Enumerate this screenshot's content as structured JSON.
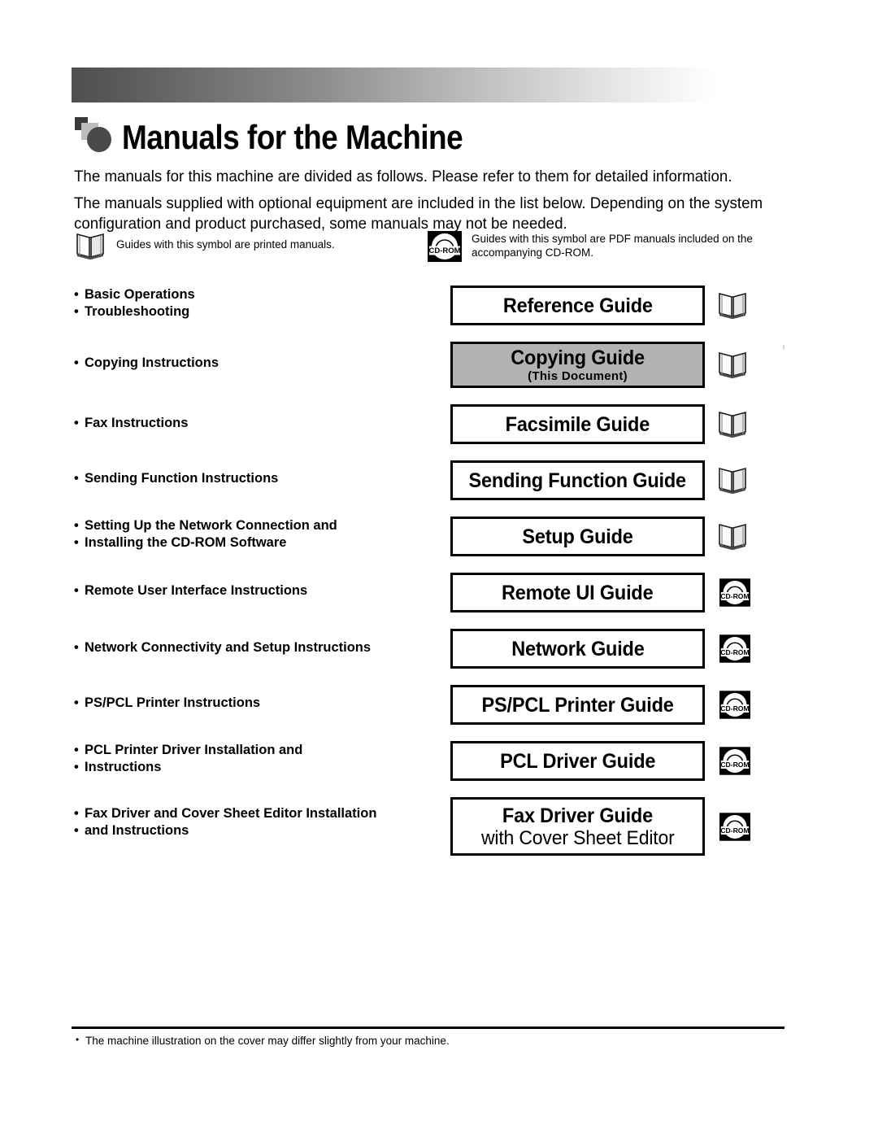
{
  "page": {
    "title": "Manuals for the Machine",
    "title_icon": "overlapping-squares-circle-icon",
    "intro_paragraphs": [
      "The manuals for this machine are divided as follows. Please refer to them for detailed information.",
      "The manuals supplied with optional equipment are included in the list below. Depending on the system configuration and product purchased, some manuals may not be needed."
    ],
    "footer_note": "The machine illustration on the cover may differ slightly from your machine."
  },
  "legend": {
    "printed": {
      "icon": "open-book-icon",
      "caption": "Guides with this symbol are printed manuals."
    },
    "pdf": {
      "icon": "cd-rom-icon",
      "icon_label": "CD-ROM",
      "caption": "Guides with this symbol are PDF manuals included on the accompanying CD-ROM."
    }
  },
  "colors": {
    "highlight_gray": "#b3b3b3",
    "banner_dark": "#4f4f4f",
    "border": "#000000",
    "text": "#000000"
  },
  "rows": [
    {
      "descriptions": [
        "Basic Operations",
        "Troubleshooting"
      ],
      "guide_title": "Reference Guide",
      "guide_subtitle": "",
      "media": "printed",
      "highlighted": false
    },
    {
      "descriptions": [
        "Copying Instructions"
      ],
      "guide_title": "Copying Guide",
      "guide_subtitle": "(This Document)",
      "media": "printed",
      "highlighted": true
    },
    {
      "descriptions": [
        "Fax Instructions"
      ],
      "guide_title": "Facsimile Guide",
      "guide_subtitle": "",
      "media": "printed",
      "highlighted": false
    },
    {
      "descriptions": [
        "Sending Function Instructions"
      ],
      "guide_title": "Sending Function Guide",
      "guide_subtitle": "",
      "media": "printed",
      "highlighted": false
    },
    {
      "descriptions": [
        "Setting Up the Network Connection and",
        "Installing the CD-ROM Software"
      ],
      "guide_title": "Setup Guide",
      "guide_subtitle": "",
      "media": "printed",
      "highlighted": false
    },
    {
      "descriptions": [
        "Remote User Interface Instructions"
      ],
      "guide_title": "Remote UI Guide",
      "guide_subtitle": "",
      "media": "cdrom",
      "highlighted": false
    },
    {
      "descriptions": [
        "Network Connectivity and Setup Instructions"
      ],
      "guide_title": "Network Guide",
      "guide_subtitle": "",
      "media": "cdrom",
      "highlighted": false
    },
    {
      "descriptions": [
        "PS/PCL Printer Instructions"
      ],
      "guide_title": "PS/PCL Printer Guide",
      "guide_subtitle": "",
      "media": "cdrom",
      "highlighted": false
    },
    {
      "descriptions": [
        "PCL Printer Driver Installation and",
        "Instructions"
      ],
      "guide_title": "PCL Driver Guide",
      "guide_subtitle": "",
      "media": "cdrom",
      "highlighted": false
    },
    {
      "descriptions": [
        "Fax Driver and Cover Sheet Editor Installation",
        "and Instructions"
      ],
      "guide_title": "Fax Driver Guide",
      "guide_subtitle": "with Cover Sheet Editor",
      "media": "cdrom",
      "highlighted": false
    }
  ]
}
